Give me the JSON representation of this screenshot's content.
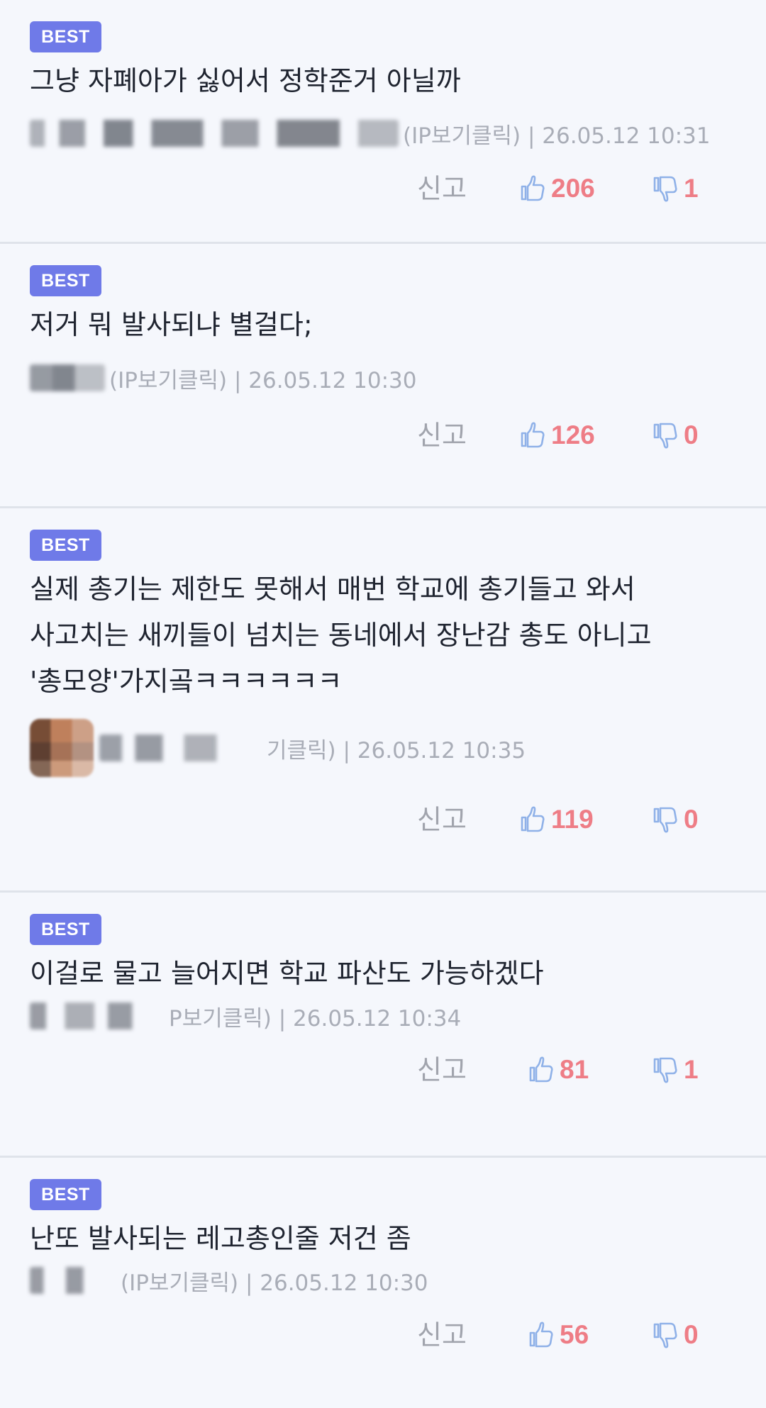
{
  "comments": [
    {
      "badge": "BEST",
      "text": "그냥 자폐아가 싫어서 정학준거 아닐까",
      "meta_tail": "(IP보기클릭) | 26.05.12 10:31",
      "report_label": "신고",
      "likes": "206",
      "dislikes": "1"
    },
    {
      "badge": "BEST",
      "text": "저거 뭐 발사되냐 별걸다;",
      "meta_tail": "(IP보기클릭) | 26.05.12 10:30",
      "report_label": "신고",
      "likes": "126",
      "dislikes": "0"
    },
    {
      "badge": "BEST",
      "text": "실제 총기는 제한도 못해서 매번 학교에 총기들고 와서 사고치는 새끼들이 넘치는 동네에서 장난감 총도 아니고 '총모양'가지곸ㅋㅋㅋㅋㅋㅋ",
      "meta_tail": "기클릭) | 26.05.12 10:35",
      "report_label": "신고",
      "likes": "119",
      "dislikes": "0"
    },
    {
      "badge": "BEST",
      "text": "이걸로 물고 늘어지면 학교 파산도 가능하겠다",
      "meta_tail": "P보기클릭) | 26.05.12 10:34",
      "report_label": "신고",
      "likes": "81",
      "dislikes": "1"
    },
    {
      "badge": "BEST",
      "text": "난또 발사되는 레고총인줄 저건 좀",
      "meta_tail": "(IP보기클릭) | 26.05.12 10:30",
      "report_label": "신고",
      "likes": "56",
      "dislikes": "0"
    }
  ],
  "colors": {
    "background": "#f5f7fc",
    "badge": "#6f7ae8",
    "count": "#ee7d86",
    "thumb_icon": "#8fb1e8",
    "meta": "#a9adb7",
    "divider": "#dfe3ea"
  },
  "icons": {
    "like": "thumbs-up-icon",
    "dislike": "thumbs-down-icon"
  }
}
